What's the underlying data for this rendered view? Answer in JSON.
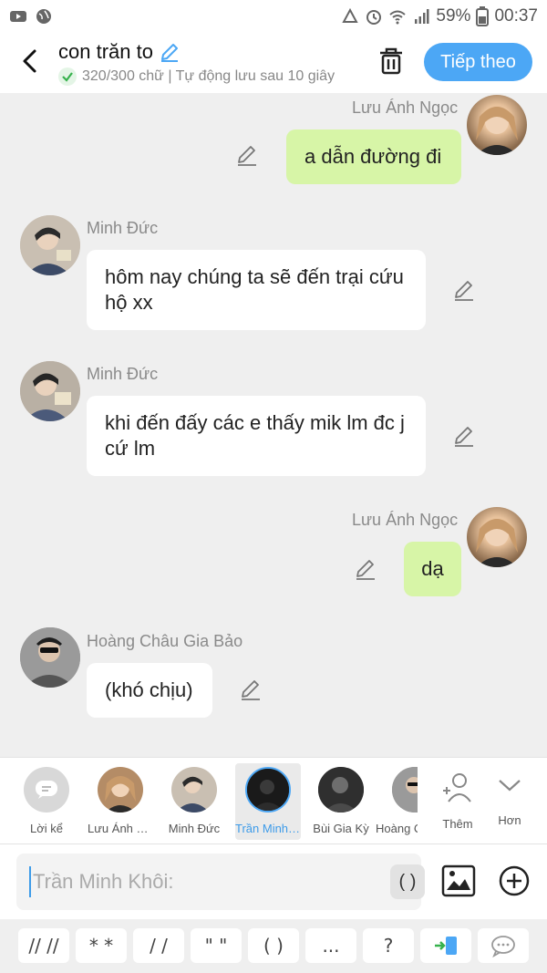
{
  "status_bar": {
    "battery": "59%",
    "time": "00:37"
  },
  "header": {
    "title": "con trăn to",
    "subtitle": "320/300 chữ | Tự động lưu sau 10 giây",
    "next_label": "Tiếp theo"
  },
  "messages": [
    {
      "sender": "Lưu Ánh Ngọc",
      "text": "a dẫn đường đi",
      "side": "right"
    },
    {
      "sender": "Minh Đức",
      "text": "hôm nay chúng ta sẽ đến trại cứu hộ xx",
      "side": "left"
    },
    {
      "sender": "Minh Đức",
      "text": "khi đến đấy các e thấy mik lm đc j cứ lm",
      "side": "left"
    },
    {
      "sender": "Lưu Ánh Ngọc",
      "text": "dạ",
      "side": "right"
    },
    {
      "sender": "Hoàng Châu Gia Bảo",
      "text": "(khó chịu)",
      "side": "left"
    }
  ],
  "characters": [
    {
      "label": "Lời kể"
    },
    {
      "label": "Lưu Ánh Ngọc"
    },
    {
      "label": "Minh Đức"
    },
    {
      "label": "Trần Minh Khôi"
    },
    {
      "label": "Bùi Gia Kỳ"
    },
    {
      "label": "Hoàng Châu Gia Bảo"
    },
    {
      "label": "Thêm"
    },
    {
      "label": "Hơn"
    }
  ],
  "input": {
    "placeholder": "Trần Minh Khôi:",
    "paren_label": "( )"
  },
  "symbols": [
    "// //",
    "* *",
    "/ /",
    "\" \"",
    "( )",
    "...",
    "?"
  ],
  "colors": {
    "accent": "#4ca7f5",
    "out_bubble": "#d7f5a7",
    "in_bubble": "#ffffff"
  }
}
